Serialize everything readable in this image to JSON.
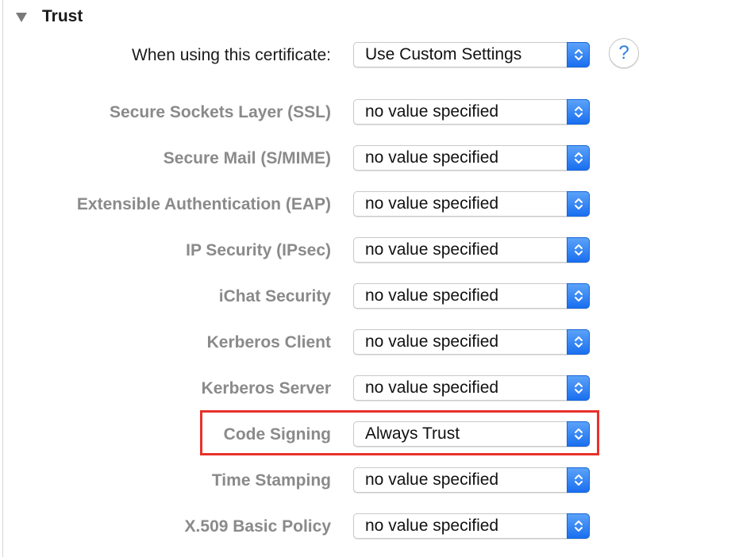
{
  "section": {
    "title": "Trust",
    "disclosure_icon": "triangle-down-icon"
  },
  "certificate_policy": {
    "label": "When using this certificate:",
    "value": "Use Custom Settings"
  },
  "help": {
    "glyph": "?",
    "icon": "help-icon"
  },
  "trust_rows": [
    {
      "label": "Secure Sockets Layer (SSL)",
      "value": "no value specified"
    },
    {
      "label": "Secure Mail (S/MIME)",
      "value": "no value specified"
    },
    {
      "label": "Extensible Authentication (EAP)",
      "value": "no value specified"
    },
    {
      "label": "IP Security (IPsec)",
      "value": "no value specified"
    },
    {
      "label": "iChat Security",
      "value": "no value specified"
    },
    {
      "label": "Kerberos Client",
      "value": "no value specified"
    },
    {
      "label": "Kerberos Server",
      "value": "no value specified"
    },
    {
      "label": "Code Signing",
      "value": "Always Trust"
    },
    {
      "label": "Time Stamping",
      "value": "no value specified"
    },
    {
      "label": "X.509 Basic Policy",
      "value": "no value specified"
    }
  ],
  "highlighted_row": "Code Signing",
  "colors": {
    "accent_blue": "#1a6ff0",
    "highlight_red": "#e8312a",
    "disabled_label_gray": "#8a8a8a"
  }
}
